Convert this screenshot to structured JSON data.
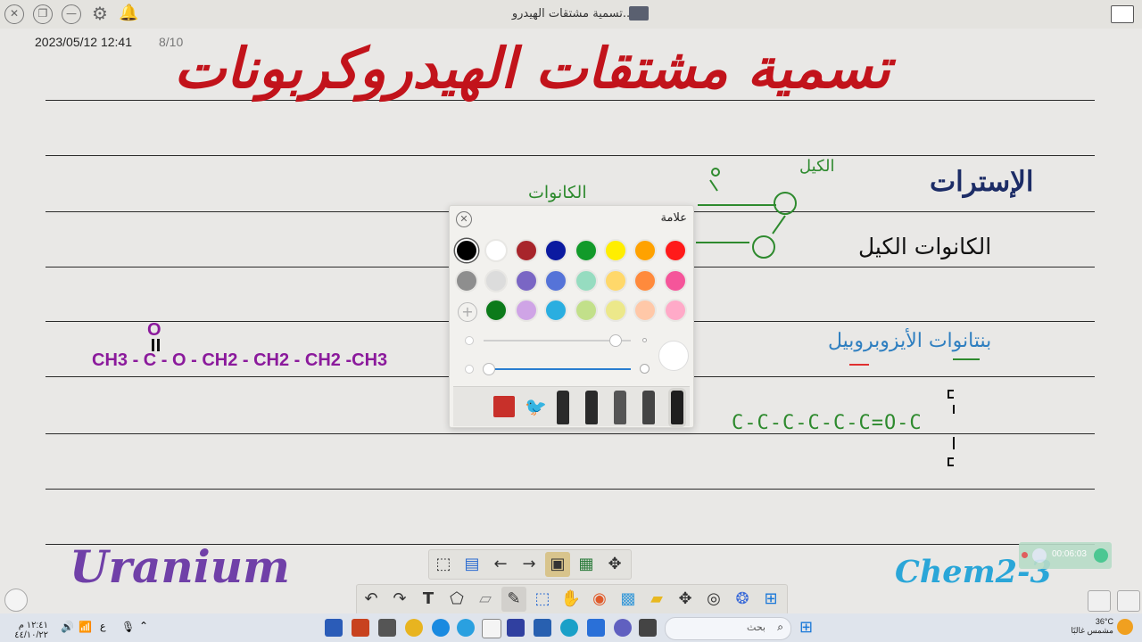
{
  "window": {
    "title": "تسمية مشتقات الهيدرو..",
    "date_time": "2023/05/12  12:41",
    "page_counter": "8/10"
  },
  "board": {
    "title": "تسمية مشتقات الهيدروكربونات",
    "esters_heading": "الإسترات",
    "general_name": "الكانوات الكيل",
    "example_name": "بنتانوات الأيزوبروبيل",
    "alkanoate_label": "الكانوات",
    "alkyl_label": "الكيل",
    "formula": "CH3 - C - O - CH2 - CH2 - CH2 -CH3",
    "formula_top": "O",
    "chain_formula": "C-C-C-C-C-C=O-C",
    "signature_left": "Uranium",
    "signature_right": "Chem2-3"
  },
  "color_panel": {
    "title": "علامة",
    "colors": [
      "#000000",
      "#ffffff",
      "#a8252b",
      "#0b1aa0",
      "#129a2a",
      "#ffee00",
      "#ffa200",
      "#ff1a1a",
      "#8e8e8e",
      "#dcdcdc",
      "#7a66c4",
      "#5573d8",
      "#96dcc0",
      "#ffd86a",
      "#ff8a3c",
      "#f5559a",
      "#0c7a1a",
      "#cfa4e6",
      "#2aaee0",
      "#c2e08a",
      "#ece88a",
      "#ffc8a8",
      "#ffaac8"
    ]
  },
  "recorder": {
    "time": "00:06:03"
  },
  "taskbar": {
    "search_placeholder": "بحث",
    "weather_temp": "36°C",
    "weather_text": "مشمس غالبًا",
    "clock_time": "١٢:٤١ م",
    "clock_date": "٤٤/١٠/٢٢",
    "lang": "ع"
  }
}
